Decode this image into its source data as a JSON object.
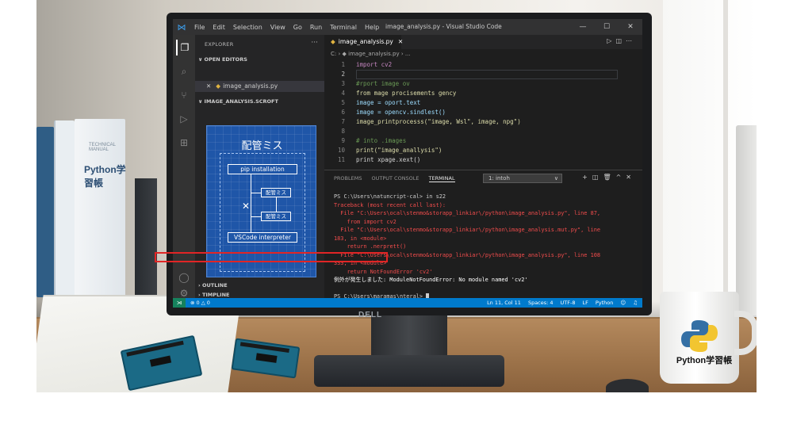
{
  "titlebar": {
    "menu": [
      "File",
      "Edit",
      "Selection",
      "View",
      "Go",
      "Run",
      "Terminal",
      "Help"
    ],
    "window_title": "image_analysis.py - Visual Studio Code"
  },
  "sidebar": {
    "title": "EXPLORER",
    "open_editors_header": "OPEN EDITORS",
    "open_file": "image_analysis.py",
    "folder_header": "IMAGE_ANALYSIS.SCROFT",
    "outline_header": "OUTLINE",
    "timeline_header": "TIMPLINE"
  },
  "diagram": {
    "title": "配管ミス",
    "box_pip": "pip installation",
    "box_error1": "配管ミス",
    "box_error2": "配管ミス",
    "box_vscode": "VSCode interpreter"
  },
  "editor": {
    "tab_label": "image_analysis.py",
    "breadcrumb_drive": "C:",
    "breadcrumb_file": "image_analysis.py",
    "breadcrumb_tail": "...",
    "code_lines": [
      {
        "n": "1",
        "text": "import cv2"
      },
      {
        "n": "2",
        "text": ""
      },
      {
        "n": "3",
        "text": "#rport image ov"
      },
      {
        "n": "4",
        "text": "from mage procisements gency"
      },
      {
        "n": "5",
        "text": "image = oport.text"
      },
      {
        "n": "6",
        "text": "image = opencv.sindlest()"
      },
      {
        "n": "7",
        "text": "image_printprocesss(\"image, Wsl\", image, npg\")"
      },
      {
        "n": "8",
        "text": ""
      },
      {
        "n": "9",
        "text": "# into .images"
      },
      {
        "n": "10",
        "text": "print(\"image_anallysis\")"
      },
      {
        "n": "11",
        "text": "print xpage.xext()"
      }
    ]
  },
  "panel": {
    "tabs": [
      "PROBLEMS",
      "OUTPUT CONSOLE",
      "TERMINAL"
    ],
    "terminal_select": "1: intoh",
    "lines": [
      {
        "text": "PS C:\\Users\\natuncript-cal> in s22",
        "err": false
      },
      {
        "text": "Traceback (most recent call last):",
        "err": true
      },
      {
        "text": "  File \"C:\\Users\\ocal\\stenmo&storapp_linkiar\\/python\\image_analysis.py\", line 87,",
        "err": true
      },
      {
        "text": "    from import cv2",
        "err": true
      },
      {
        "text": "  File \"C:\\Users\\ocal\\stenmo&storapp_linkiar\\/python\\image_analysis.mut.py\", line",
        "err": true
      },
      {
        "text": "183, in <module>",
        "err": true
      },
      {
        "text": "    return .nerprett()",
        "err": true
      },
      {
        "text": "  File \"C:\\Users\\ocal\\stenmo&storapp_linkiar\\/python\\image_analysis.py\", line 108",
        "err": true
      },
      {
        "text": "333, in <module>",
        "err": true
      },
      {
        "text": "    return NotFoundError 'cv2'",
        "err": true
      }
    ],
    "error_message": "例外が発生しました: ModuleNotFoundError: No module named 'cv2'",
    "prompt": "PS C:\\Users\\maramas\\nteral> "
  },
  "statusbar": {
    "problems": "⊗ 0 △ 0",
    "position": "Ln 11, Col 11",
    "spaces": "Spaces: 4",
    "encoding": "UTF-8",
    "eol": "LF",
    "language": "Python"
  },
  "scene": {
    "book_spine_text": "Python学習帳",
    "book_spine_sub": "TECHNICAL MANUAL",
    "monitor_brand": "DELL",
    "mug_text": "Python学習帳"
  },
  "colors": {
    "statusbar": "#007acc",
    "error_text": "#f14c4c",
    "error_box": "#e12525",
    "blueprint": "#1f56a8"
  }
}
